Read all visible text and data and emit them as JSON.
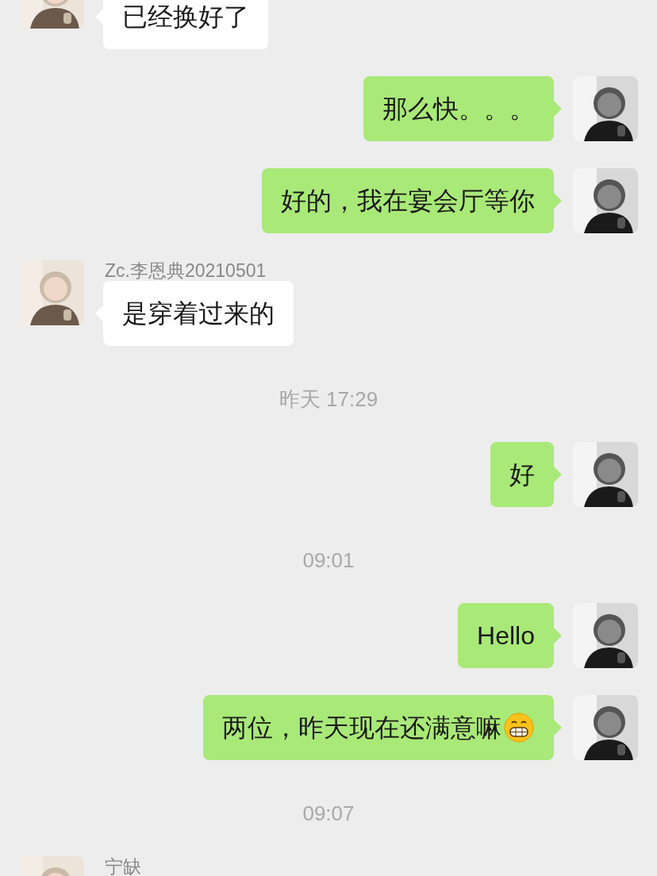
{
  "chat": [
    {
      "kind": "incoming",
      "text": "已经换好了",
      "emoji": false
    },
    {
      "kind": "outgoing",
      "text": "那么快。。。",
      "emoji": false
    },
    {
      "kind": "outgoing",
      "text": "好的，我在宴会厅等你",
      "emoji": false
    },
    {
      "kind": "incoming",
      "sender": "Zc.李恩典20210501",
      "text": "是穿着过来的",
      "emoji": false
    },
    {
      "kind": "time",
      "text": "昨天 17:29"
    },
    {
      "kind": "outgoing",
      "text": "好",
      "emoji": false
    },
    {
      "kind": "time",
      "text": "09:01"
    },
    {
      "kind": "outgoing",
      "text": "Hello",
      "emoji": false
    },
    {
      "kind": "outgoing",
      "text": "两位，昨天现在还满意嘛",
      "emoji": true
    },
    {
      "kind": "time",
      "text": "09:07"
    },
    {
      "kind": "incoming",
      "sender": "宁缺"
    }
  ]
}
